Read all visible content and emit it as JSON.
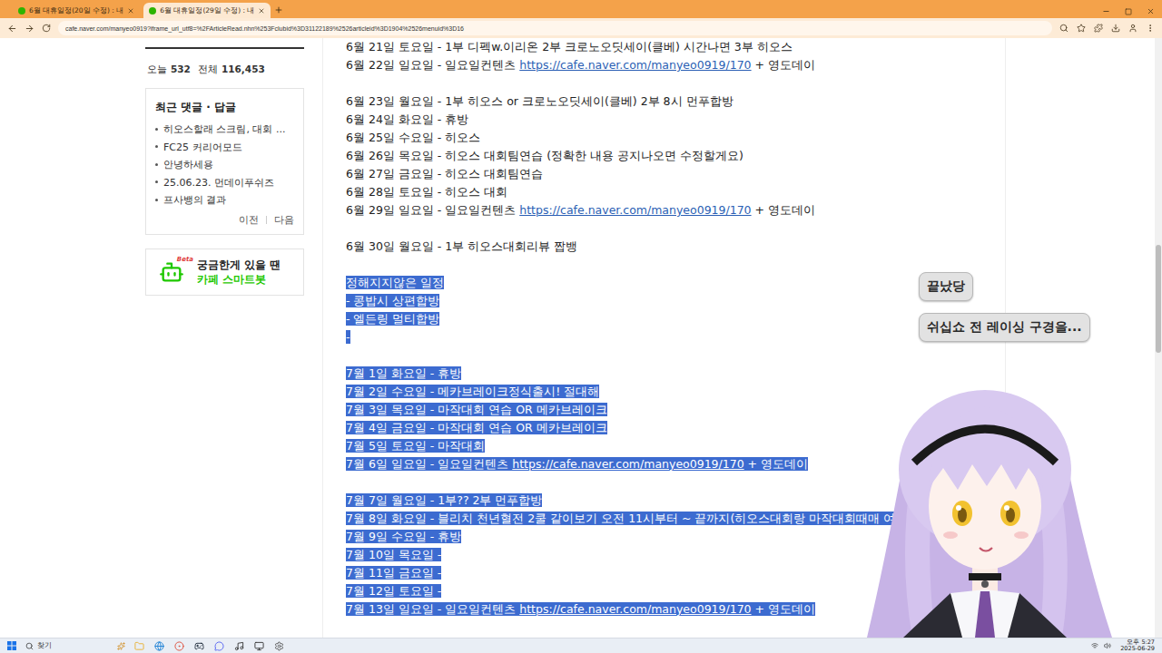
{
  "browser": {
    "tabs": [
      {
        "label": "6월 대휴일정(20일 수정) : 내",
        "selected": false
      },
      {
        "label": "6월 대휴일정(29일 수정) : 내",
        "selected": true
      }
    ],
    "address": "cafe.naver.com/manyeo0919?iframe_url_utf8=%2FArticleRead.nhn%253Fclubid%3D31122189%2526articleid%3D1904%2526menuid%3D16"
  },
  "sidebar": {
    "stats": [
      {
        "label": "오늘",
        "value": "532"
      },
      {
        "label": "전체",
        "value": "116,453"
      }
    ],
    "recent": {
      "title": "최근 댓글 · 답글",
      "items": [
        "히오스할래 스크림, 대회 ...",
        "FC25 커리어모드",
        "안녕하세용",
        "25.06.23. 먼데이푸쉬즈",
        "프사뱅의 결과"
      ],
      "prev": "이전",
      "next": "다음"
    },
    "bot": {
      "badge": "Beta",
      "line1": "궁금한게 있을 땐",
      "line2": "카페 스마트봇"
    }
  },
  "article": {
    "lines": [
      {
        "kind": "text",
        "text": "6월 21일 토요일 - 1부 디펙w.이리온 2부 크로노오딧세이(클베) 시간나면 3부 히오스",
        "link": "",
        "after": "",
        "selected": false
      },
      {
        "kind": "text",
        "text": "6월 22일 일요일 - 일요일컨텐츠 ",
        "link": "https://cafe.naver.com/manyeo0919/170",
        "after": " + 영도데이",
        "selected": false
      },
      {
        "kind": "blank",
        "text": "",
        "link": "",
        "after": "",
        "selected": false
      },
      {
        "kind": "text",
        "text": "6월 23일 월요일 - 1부 히오스 or 크로노오딧세이(클베) 2부 8시 먼푸합방",
        "link": "",
        "after": "",
        "selected": false
      },
      {
        "kind": "text",
        "text": "6월 24일 화요일 - 휴방",
        "link": "",
        "after": "",
        "selected": false
      },
      {
        "kind": "text",
        "text": "6월 25일 수요일 - 히오스",
        "link": "",
        "after": "",
        "selected": false
      },
      {
        "kind": "text",
        "text": "6월 26일 목요일 - 히오스 대회팀연습 (정확한 내용 공지나오면 수정할게요)",
        "link": "",
        "after": "",
        "selected": false
      },
      {
        "kind": "text",
        "text": "6월 27일 금요일 - 히오스 대회팀연습",
        "link": "",
        "after": "",
        "selected": false
      },
      {
        "kind": "text",
        "text": "6월 28일 토요일 - 히오스 대회",
        "link": "",
        "after": "",
        "selected": false
      },
      {
        "kind": "text",
        "text": "6월 29일 일요일 - 일요일컨텐츠 ",
        "link": "https://cafe.naver.com/manyeo0919/170",
        "after": " + 영도데이",
        "selected": false
      },
      {
        "kind": "blank",
        "text": "",
        "link": "",
        "after": "",
        "selected": false
      },
      {
        "kind": "text",
        "text": "6월 30일 월요일 - 1부 히오스대회리뷰 짭뱅",
        "link": "",
        "after": "",
        "selected": false
      },
      {
        "kind": "blank",
        "text": "",
        "link": "",
        "after": "",
        "selected": false
      },
      {
        "kind": "text",
        "text": "정해지지않은 일정",
        "link": "",
        "after": "",
        "selected": true
      },
      {
        "kind": "text",
        "text": "- 콩밥시 상편합방",
        "link": "",
        "after": "",
        "selected": true
      },
      {
        "kind": "text",
        "text": "- 엘든링 멀티합방",
        "link": "",
        "after": "",
        "selected": true
      },
      {
        "kind": "text",
        "text": "-",
        "link": "",
        "after": "",
        "selected": true
      },
      {
        "kind": "blank",
        "text": "",
        "link": "",
        "after": "",
        "selected": false
      },
      {
        "kind": "text",
        "text": "7월 1일 화요일 - 휴방",
        "link": "",
        "after": "",
        "selected": true
      },
      {
        "kind": "text",
        "text": "7월 2일 수요일 - 메카브레이크정식출시! 절대해",
        "link": "",
        "after": "",
        "selected": true
      },
      {
        "kind": "text",
        "text": "7월 3일 목요일 - 마작대회 연습 OR 메카브레이크",
        "link": "",
        "after": "",
        "selected": true
      },
      {
        "kind": "text",
        "text": "7월 4일 금요일 - 마작대회 연습 OR 메카브레이크",
        "link": "",
        "after": "",
        "selected": true
      },
      {
        "kind": "text",
        "text": "7월 5일 토요일 - 마작대회",
        "link": "",
        "after": "",
        "selected": true
      },
      {
        "kind": "text",
        "text": "7월 6일 일요일 - 일요일컨텐츠 ",
        "link": "https://cafe.naver.com/manyeo0919/170",
        "after": " + 영도데이",
        "selected": true
      },
      {
        "kind": "blank",
        "text": "",
        "link": "",
        "after": "",
        "selected": false
      },
      {
        "kind": "text",
        "text": "7월 7일 월요일 - 1부?? 2부 먼푸합방",
        "link": "",
        "after": "",
        "selected": true
      },
      {
        "kind": "text",
        "text": "7월 8일 화요일 - 블리치 천년혈전 2쿨 같이보기 오전 11시부터 ~ 끝까지(히오스대회랑 마작대회때매 여기로왔어잉)",
        "link": "",
        "after": "",
        "selected": true
      },
      {
        "kind": "text",
        "text": "7월 9일 수요일 - 휴방",
        "link": "",
        "after": "",
        "selected": true
      },
      {
        "kind": "text",
        "text": "7월 10일 목요일 -",
        "link": "",
        "after": "",
        "selected": true
      },
      {
        "kind": "text",
        "text": "7월 11일 금요일 -",
        "link": "",
        "after": "",
        "selected": true
      },
      {
        "kind": "text",
        "text": "7월 12일 토요일 -",
        "link": "",
        "after": "",
        "selected": true
      },
      {
        "kind": "text",
        "text": "7월 13일 일요일 - 일요일컨텐츠 ",
        "link": "https://cafe.naver.com/manyeo0919/170",
        "after": " + 영도데이",
        "selected": true
      }
    ]
  },
  "chat": [
    "끝났당",
    "쉬십쇼 전 레이싱 구경을..."
  ],
  "scrollbar": {
    "offset": 0.345,
    "size": 0.18
  },
  "taskbar": {
    "search": "찾기",
    "time": "오후 5:27",
    "date": "2025-06-29"
  }
}
